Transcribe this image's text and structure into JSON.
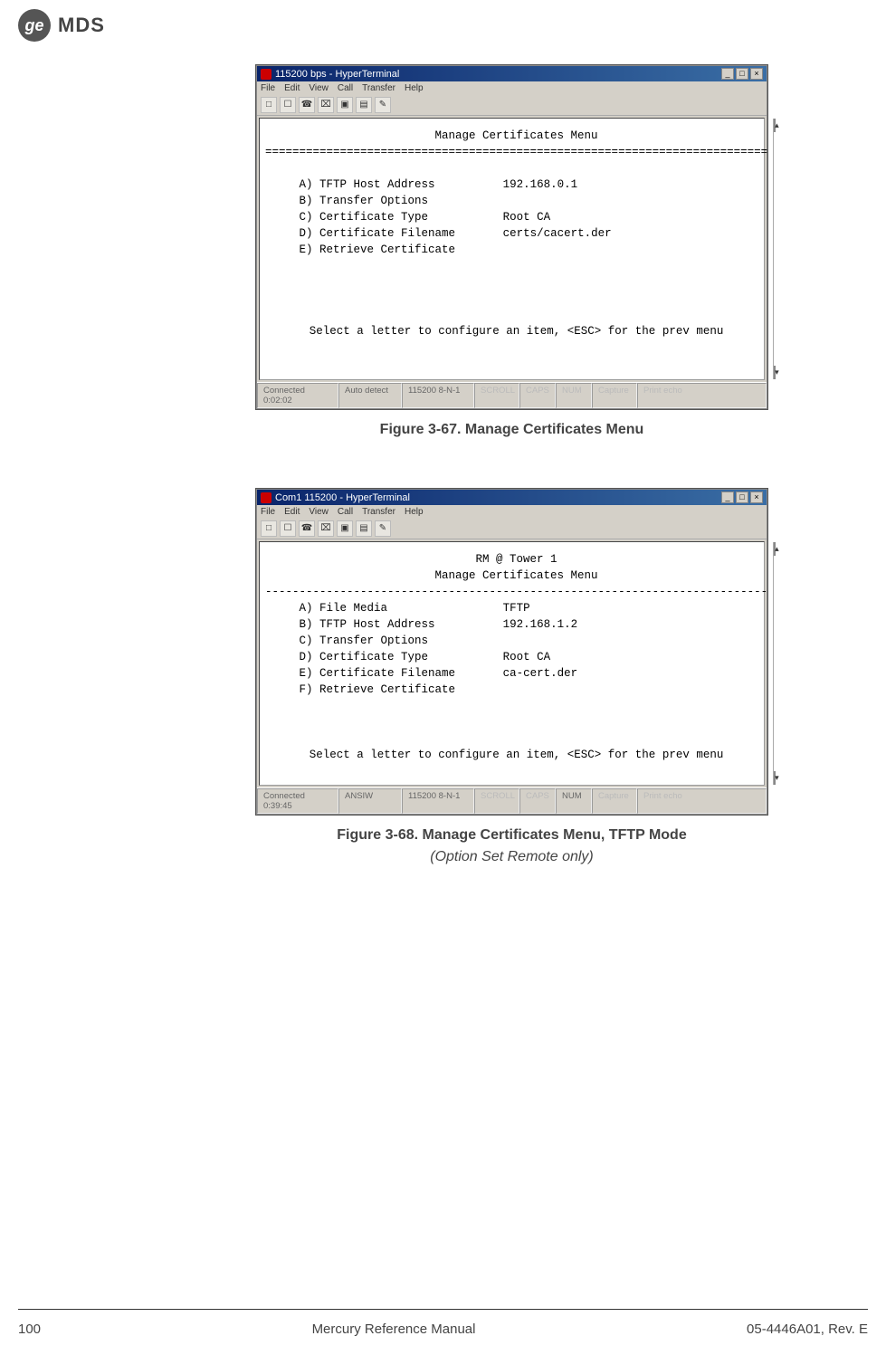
{
  "header": {
    "brand1": "ge",
    "brand2": "MDS"
  },
  "fig1": {
    "window_title": "115200 bps - HyperTerminal",
    "menubar": [
      "File",
      "Edit",
      "View",
      "Call",
      "Transfer",
      "Help"
    ],
    "title_line": "Manage Certificates Menu",
    "divider": "==========================================================================",
    "rows": [
      {
        "k": "A) TFTP Host Address",
        "v": "192.168.0.1"
      },
      {
        "k": "B) Transfer Options",
        "v": ""
      },
      {
        "k": "C) Certificate Type",
        "v": "Root CA"
      },
      {
        "k": "D) Certificate Filename",
        "v": "certs/cacert.der"
      },
      {
        "k": "E) Retrieve Certificate",
        "v": ""
      }
    ],
    "footer_line": "Select a letter to configure an item, <ESC> for the prev menu",
    "status": {
      "conn": "Connected 0:02:02",
      "detect": "Auto detect",
      "port": "115200 8-N-1",
      "scroll": "SCROLL",
      "caps": "CAPS",
      "num": "NUM",
      "capture": "Capture",
      "print": "Print echo"
    },
    "caption": "Figure 3-67. Manage Certificates Menu"
  },
  "fig2": {
    "window_title": "Com1 115200 - HyperTerminal",
    "menubar": [
      "File",
      "Edit",
      "View",
      "Call",
      "Transfer",
      "Help"
    ],
    "title_line1": "RM @ Tower 1",
    "title_line2": "Manage Certificates Menu",
    "divider": "--------------------------------------------------------------------------",
    "rows": [
      {
        "k": "A) File Media",
        "v": "TFTP"
      },
      {
        "k": "B) TFTP Host Address",
        "v": "192.168.1.2"
      },
      {
        "k": "C) Transfer Options",
        "v": ""
      },
      {
        "k": "D) Certificate Type",
        "v": "Root CA"
      },
      {
        "k": "E) Certificate Filename",
        "v": "ca-cert.der"
      },
      {
        "k": "F) Retrieve Certificate",
        "v": ""
      }
    ],
    "footer_line": "Select a letter to configure an item, <ESC> for the prev menu",
    "status": {
      "conn": "Connected 0:39:45",
      "detect": "ANSIW",
      "port": "115200 8-N-1",
      "scroll": "SCROLL",
      "caps": "CAPS",
      "num": "NUM",
      "capture": "Capture",
      "print": "Print echo"
    },
    "caption": "Figure 3-68. Manage Certificates Menu, TFTP Mode",
    "subcaption": "(Option Set Remote only)"
  },
  "footer": {
    "page": "100",
    "title": "Mercury Reference Manual",
    "doc": "05-4446A01, Rev. E"
  }
}
